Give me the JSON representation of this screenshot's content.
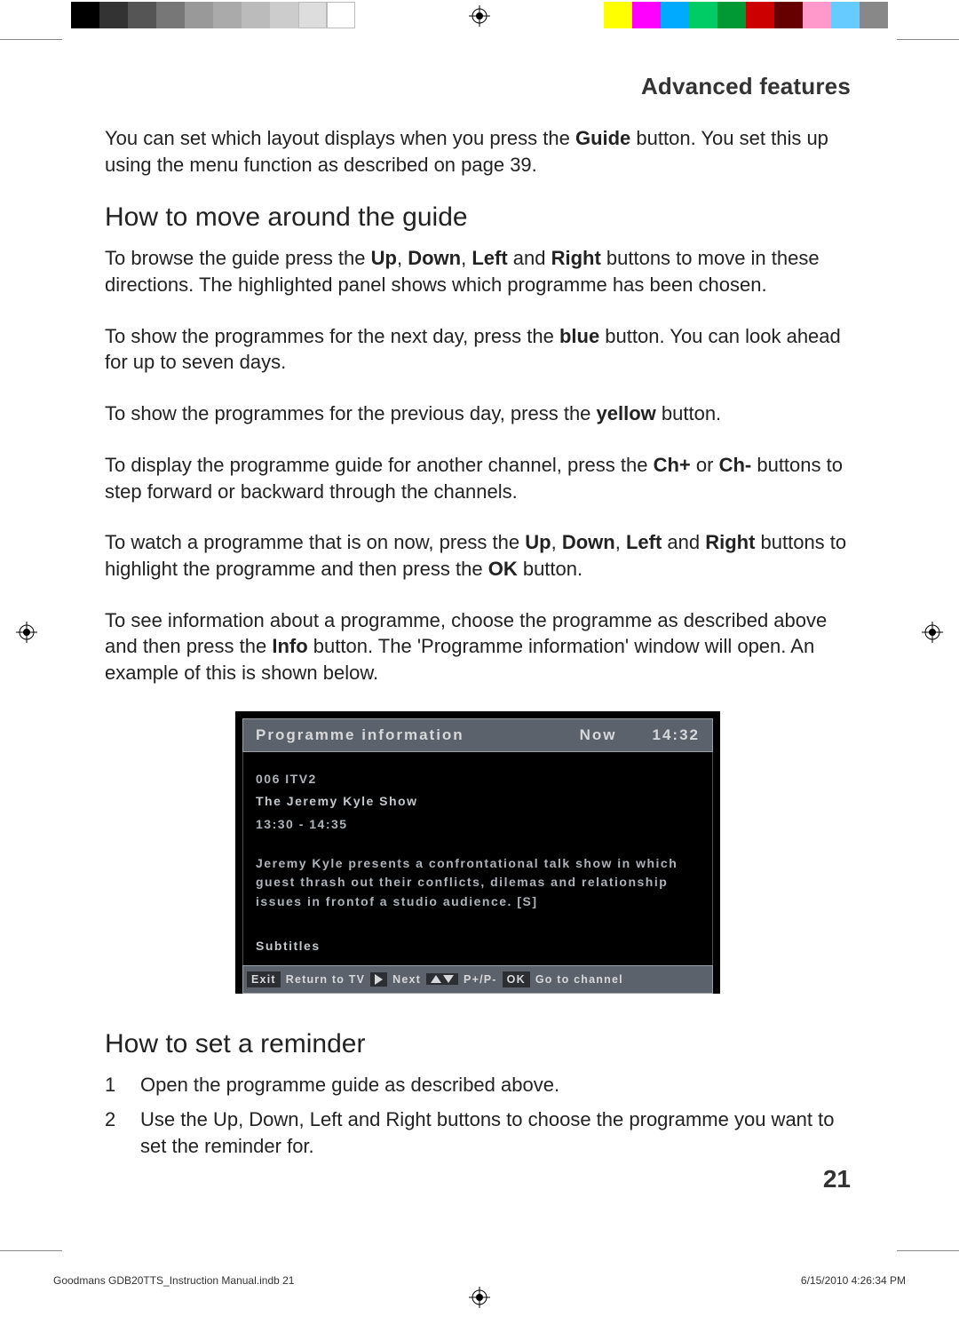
{
  "header": {
    "section_title": "Advanced features"
  },
  "paragraphs": {
    "intro": {
      "pre": "You can set which layout displays when you press the ",
      "bold1": "Guide",
      "post": " button. You set this up using the menu function as described on page 39."
    },
    "h_move": "How to move around the guide",
    "browse": {
      "pre": "To browse the guide press the ",
      "b1": "Up",
      "c1": ", ",
      "b2": "Down",
      "c2": ", ",
      "b3": "Left",
      "c3": " and ",
      "b4": "Right",
      "post": " buttons to move in these directions. The highlighted panel shows which programme has been chosen."
    },
    "nextday": {
      "pre": "To show the programmes for the next day, press the ",
      "b1": "blue",
      "post": " button. You can look ahead for up to seven days."
    },
    "prevday": {
      "pre": "To show the programmes for the previous day, press the ",
      "b1": "yellow",
      "post": " button."
    },
    "channel": {
      "pre": "To display the programme guide for another channel, press the ",
      "b1": "Ch+",
      "mid": " or ",
      "b2": "Ch-",
      "post": " buttons to step forward or backward through the channels."
    },
    "watch": {
      "pre": "To watch a programme that is on now, press the ",
      "b1": "Up",
      "c1": ", ",
      "b2": "Down",
      "c2": ", ",
      "b3": "Left",
      "c3": " and ",
      "b4": "Right",
      "mid": " buttons to highlight the programme and then press the ",
      "b5": "OK",
      "post": " button."
    },
    "info": {
      "pre": "To see information about a programme, choose the programme as described above and then press the ",
      "b1": "Info",
      "post": " button. The 'Programme information' window will open. An example of this is shown below."
    },
    "h_reminder": "How to set a reminder",
    "step1": "Open the programme guide as described above.",
    "step2": {
      "pre": "Use the ",
      "b1": "Up",
      "c1": ", ",
      "b2": "Down",
      "c2": ", ",
      "b3": "Left",
      "c3": " and ",
      "b4": "Right",
      "post": " buttons to choose the programme you want to set the reminder for."
    }
  },
  "info_window": {
    "title": "Programme information",
    "now_label": "Now",
    "clock": "14:32",
    "channel_line": "006   ITV2",
    "show_name": "The Jeremy Kyle Show",
    "time_slot": "13:30 - 14:35",
    "description": "Jeremy Kyle presents a confrontational talk show in which guest thrash out their conflicts, dilemas and relationship issues in frontof a studio audience. [S]",
    "subtitles_label": "Subtitles",
    "footer": {
      "exit": "Exit",
      "return": "Return to TV",
      "next": "Next",
      "pplus": "P+/P-",
      "ok": "OK",
      "go": "Go to channel"
    }
  },
  "page_number": "21",
  "print_footer": {
    "left": "Goodmans GDB20TTS_Instruction Manual.indb   21",
    "right": "6/15/2010   4:26:34 PM"
  },
  "colorbar_left": [
    "#000000",
    "#333333",
    "#555555",
    "#777777",
    "#999999",
    "#aaaaaa",
    "#bbbbbb",
    "#cccccc",
    "#dddddd",
    "#ffffff"
  ],
  "colorbar_right": [
    "#ffff00",
    "#ff00ff",
    "#00aaff",
    "#00cc66",
    "#009933",
    "#cc0000",
    "#660000",
    "#ff99cc",
    "#66ccff",
    "#888888"
  ]
}
